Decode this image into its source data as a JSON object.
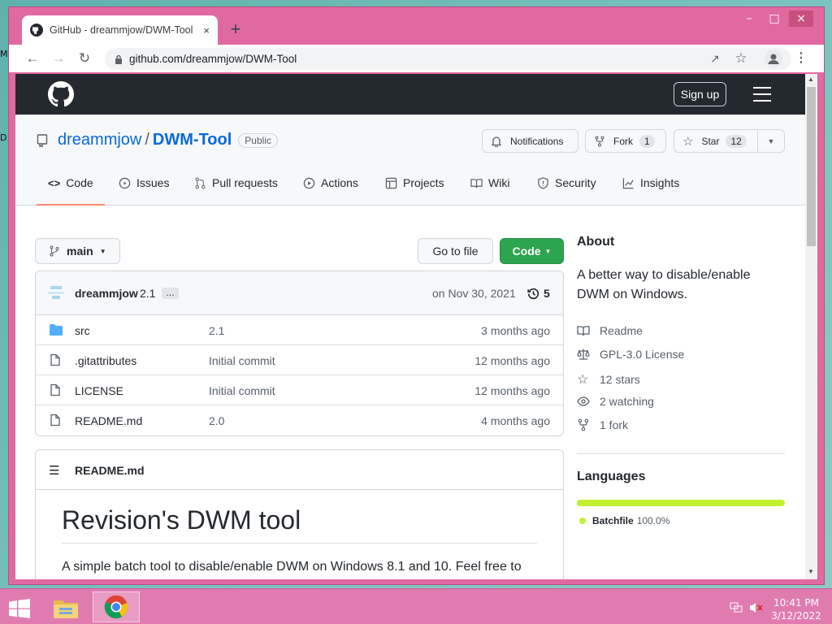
{
  "browser": {
    "tab_title": "GitHub - dreammjow/DWM-Tool",
    "close_tab": "×",
    "new_tab": "+",
    "url": "github.com/dreammjow/DWM-Tool",
    "window_controls": {
      "minimize": "–",
      "maximize": "□",
      "close": "×"
    }
  },
  "github": {
    "sign_up": "Sign up"
  },
  "repo": {
    "owner": "dreammjow",
    "separator": "/",
    "name": "DWM-Tool",
    "visibility": "Public",
    "notifications_label": "Notifications",
    "fork_label": "Fork",
    "fork_count": "1",
    "star_label": "Star",
    "star_count": "12",
    "tabs": [
      {
        "label": "Code",
        "icon": "code-icon"
      },
      {
        "label": "Issues",
        "icon": "issue-icon"
      },
      {
        "label": "Pull requests",
        "icon": "pull-request-icon"
      },
      {
        "label": "Actions",
        "icon": "play-icon"
      },
      {
        "label": "Projects",
        "icon": "table-icon"
      },
      {
        "label": "Wiki",
        "icon": "book-icon"
      },
      {
        "label": "Security",
        "icon": "shield-icon"
      },
      {
        "label": "Insights",
        "icon": "graph-icon"
      }
    ]
  },
  "files": {
    "branch": "main",
    "go_to_file": "Go to file",
    "code_button": "Code",
    "commit": {
      "author": "dreammjow",
      "message": "2.1",
      "ellipsis": "…",
      "date": "on Nov 30, 2021",
      "commit_count": "5"
    },
    "rows": [
      {
        "name": "src",
        "message": "2.1",
        "age": "3 months ago",
        "type": "folder"
      },
      {
        "name": ".gitattributes",
        "message": "Initial commit",
        "age": "12 months ago",
        "type": "file"
      },
      {
        "name": "LICENSE",
        "message": "Initial commit",
        "age": "12 months ago",
        "type": "file"
      },
      {
        "name": "README.md",
        "message": "2.0",
        "age": "4 months ago",
        "type": "file"
      }
    ]
  },
  "readme": {
    "header": "README.md",
    "title": "Revision's DWM tool",
    "text": "A simple batch tool to disable/enable DWM on Windows 8.1 and 10. Feel free to"
  },
  "about": {
    "heading": "About",
    "description": "A better way to disable/enable DWM on Windows.",
    "readme": "Readme",
    "license": "GPL-3.0 License",
    "stars": "12 stars",
    "watching": "2 watching",
    "forks": "1 fork"
  },
  "languages": {
    "heading": "Languages",
    "name": "Batchfile",
    "percent": "100.0%",
    "color": "#c1f12e"
  },
  "taskbar": {
    "time": "10:41 PM",
    "date": "3/12/2022"
  },
  "colors": {
    "window_frame": "#e06aa0",
    "github_header": "#24292f",
    "code_button": "#2da44e",
    "link": "#0969da"
  }
}
